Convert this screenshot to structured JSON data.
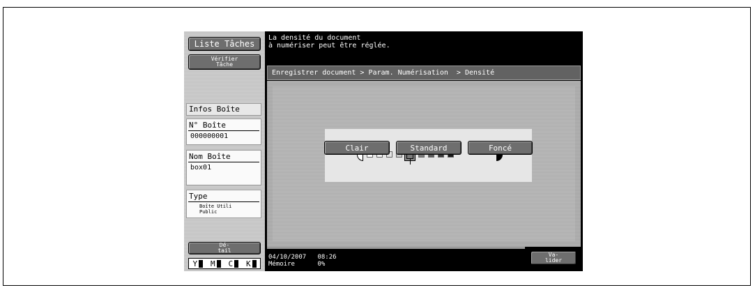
{
  "left_panel": {
    "liste_taches": "Liste Tâches",
    "verifier_tache": "Vérifier\nTâche",
    "infos_boite": "Infos Boîte",
    "no_boite_label": "N° Boîte",
    "no_boite_value": "000000001",
    "nom_boite_label": "Nom Boîte",
    "nom_boite_value": "box01",
    "type_label": "Type",
    "type_value": "Boîte Utili\nPublic",
    "detail": "Dé-\ntail",
    "toner": [
      "Y",
      "M",
      "C",
      "K"
    ]
  },
  "message": "La densité du document\nà numériser peut être réglée.",
  "breadcrumb": "Enregistrer document > Param. Numérisation  > Densité",
  "density": {
    "levels": 9,
    "selected_index": 4,
    "buttons": {
      "light": "Clair",
      "standard": "Standard",
      "dark": "Foncé"
    }
  },
  "status": {
    "date": "04/10/2007",
    "time": "08:26",
    "memory_label": "Mémoire",
    "memory_value": "0%"
  },
  "valider": "Va-\nlider",
  "colors": {
    "button_gray": "#6e6e6e",
    "panel_light": "#e6e6e6",
    "screen_black": "#000000"
  }
}
